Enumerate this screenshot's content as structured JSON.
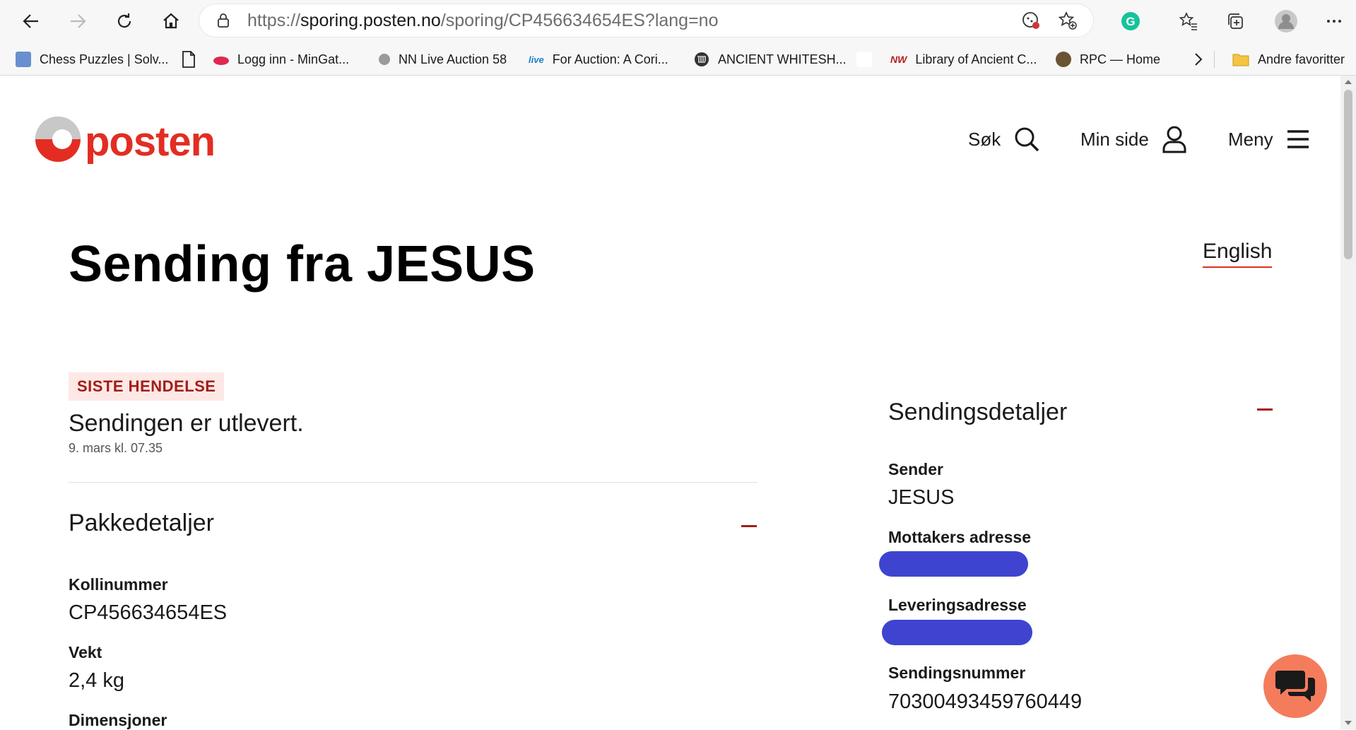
{
  "browser": {
    "url_proto": "https://",
    "url_domain": "sporing.posten.no",
    "url_path": "/sporing/CP456634654ES?lang=no",
    "bookmarks": [
      {
        "label": "Chess Puzzles | Solv...",
        "color": "#6a8fd0"
      },
      {
        "label": "",
        "color": "#ffffff"
      },
      {
        "label": "Logg inn - MinGat...",
        "color": "#e0274f"
      },
      {
        "label": "NN Live Auction 58",
        "color": "#9a9a9a"
      },
      {
        "label": "For Auction: A Cori...",
        "color": "#1c7fc6"
      },
      {
        "label": "ANCIENT WHITESH...",
        "color": "#333333"
      },
      {
        "label": "",
        "color": "#ffffff"
      },
      {
        "label": "Library of Ancient C...",
        "color": "#b52020"
      },
      {
        "label": "RPC — Home",
        "color": "#6b5433"
      }
    ],
    "other_favorites": "Andre favoritter"
  },
  "header": {
    "logo_text": "posten",
    "search_label": "Søk",
    "my_page_label": "Min side",
    "menu_label": "Meny"
  },
  "page": {
    "title": "Sending fra JESUS",
    "language_link": "English",
    "latest_badge": "SISTE HENDELSE",
    "latest_event": "Sendingen er utlevert.",
    "latest_time": "9. mars kl. 07.35"
  },
  "package": {
    "heading": "Pakkedetaljer",
    "fields": [
      {
        "label": "Kollinummer",
        "value": "CP456634654ES"
      },
      {
        "label": "Vekt",
        "value": "2,4 kg"
      },
      {
        "label": "Dimensjoner",
        "value": ""
      }
    ]
  },
  "shipment": {
    "heading": "Sendingsdetaljer",
    "sender_label": "Sender",
    "sender_value": "JESUS",
    "recipient_label": "Mottakers adresse",
    "delivery_label": "Leveringsadresse",
    "number_label": "Sendingsnummer",
    "number_value": "70300493459760449"
  },
  "colors": {
    "brand_red": "#e32d22",
    "redaction": "#3e44cf",
    "chat_bg": "#f47c5c"
  }
}
